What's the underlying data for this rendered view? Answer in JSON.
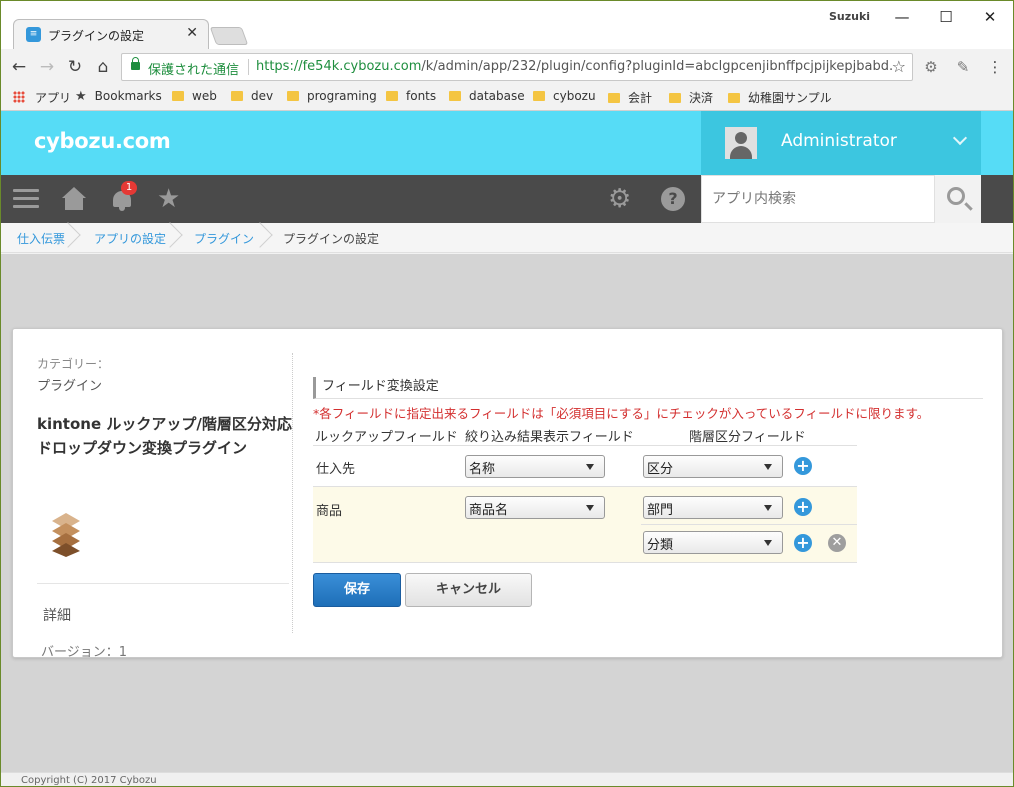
{
  "browser": {
    "tab_title": "プラグインの設定",
    "tab_icon": "list-icon",
    "user_badge": "Suzuki",
    "window_controls": {
      "minimize": "—",
      "maximize": "☐",
      "close": "✕"
    },
    "security_label": "保護された通信",
    "url_host": "https://fe54k.cybozu.com",
    "url_path": "/k/admin/app/232/plugin/config?pluginId=abclgpcenjibnffpcjpijkepjbabd...",
    "bookmarks": [
      "アプリ",
      "Bookmarks",
      "web",
      "dev",
      "programing",
      "fonts",
      "database",
      "cybozu",
      "会計",
      "決済",
      "幼稚園サンプル"
    ]
  },
  "header": {
    "logo": "cybozu.com",
    "user_name": "Administrator",
    "notification_count": "1",
    "search_placeholder": "アプリ内検索"
  },
  "breadcrumb": [
    "仕入伝票",
    "アプリの設定",
    "プラグイン",
    "プラグインの設定"
  ],
  "sidebar": {
    "category_label": "カテゴリー：",
    "category_value": "プラグイン",
    "plugin_name": "kintone ルックアップ/階層区分対応ドロップダウン変換プラグイン",
    "detail_link": "詳細",
    "version": "バージョン：1"
  },
  "config": {
    "section_title": "フィールド変換設定",
    "notice": "*各フィールドに指定出来るフィールドは「必須項目にする」にチェックが入っているフィールドに限ります。",
    "columns": [
      "ルックアップフィールド",
      "絞り込み結果表示フィールド",
      "階層区分フィールド"
    ],
    "rows": [
      {
        "lookup": "仕入先",
        "display": "名称",
        "hierarchy": [
          "区分"
        ]
      },
      {
        "lookup": "商品",
        "display": "商品名",
        "hierarchy": [
          "部門",
          "分類"
        ]
      }
    ],
    "save_label": "保存",
    "cancel_label": "キャンセル"
  },
  "footer": {
    "copyright": "Copyright (C) 2017 Cybozu"
  },
  "colors": {
    "brand": "#56dcf6",
    "user_area": "#3cc6e0",
    "nav": "#4a4a4a",
    "link": "#3498db",
    "notice": "#d32f2f",
    "save_button": "#2a7fc8"
  }
}
